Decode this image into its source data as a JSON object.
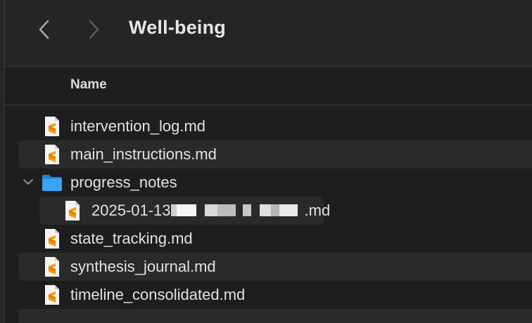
{
  "toolbar": {
    "back_icon": "chevron-left-icon",
    "forward_icon": "chevron-right-icon",
    "title": "Well-being"
  },
  "columns": {
    "name": "Name"
  },
  "files": [
    {
      "name": "intervention_log.md",
      "kind": "markdown-file",
      "icon": "sublime-doc-icon"
    },
    {
      "name": "main_instructions.md",
      "kind": "markdown-file",
      "icon": "sublime-doc-icon"
    },
    {
      "name": "progress_notes",
      "kind": "folder",
      "icon": "folder-icon",
      "expanded": true
    },
    {
      "name_prefix": "2025-01-13",
      "name_suffix": ".md",
      "kind": "markdown-file",
      "icon": "sublime-doc-icon",
      "redacted": true
    },
    {
      "name": "state_tracking.md",
      "kind": "markdown-file",
      "icon": "sublime-doc-icon"
    },
    {
      "name": "synthesis_journal.md",
      "kind": "markdown-file",
      "icon": "sublime-doc-icon"
    },
    {
      "name": "timeline_consolidated.md",
      "kind": "markdown-file",
      "icon": "sublime-doc-icon"
    }
  ],
  "colors": {
    "background": "#1e1e1e",
    "toolbar": "#252526",
    "row_alt": "#2a2a2a",
    "text": "#e2e2e2",
    "folder_blue": "#2f9cf4",
    "sublime_orange": "#ff9800"
  }
}
